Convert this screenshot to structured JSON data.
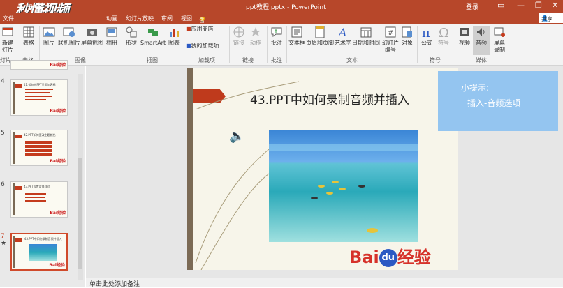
{
  "watermark": "秒懂视频",
  "window": {
    "title": "ppt教程.pptx - PowerPoint",
    "login": "登录",
    "minimize": "—",
    "restore": "❐",
    "close": "✕"
  },
  "tabs": [
    "文件",
    "动画",
    "幻灯片放映",
    "审阅",
    "视图"
  ],
  "tell_me": "告诉我你想要做什么",
  "share": "共享",
  "ribbon": {
    "new_slide": "新建\n灯片",
    "table": "表格",
    "picture": "图片",
    "online_picture": "联机图片",
    "screenshot": "屏幕截图",
    "album": "相册",
    "shapes": "形状",
    "smartart": "SmartArt",
    "chart": "图表",
    "store": "应用商店",
    "my_addins": "我的加载项",
    "link": "链接",
    "action": "动作",
    "comment": "批注",
    "textbox": "文本框",
    "header_footer": "页眉和页脚",
    "wordart": "艺术字",
    "datetime": "日期和时间",
    "slide_number": "幻灯片\n编号",
    "object": "对象",
    "equation": "公式",
    "symbol": "符号",
    "video": "视频",
    "audio": "音频",
    "screen_recording": "屏幕\n录制",
    "groups": {
      "slides": "灯片",
      "tables": "表格",
      "images": "图像",
      "illustrations": "插图",
      "addins": "加载项",
      "links": "链接",
      "comments": "批注",
      "text": "文本",
      "symbols": "符号",
      "media": "媒体"
    }
  },
  "thumbnails": [
    {
      "num": "4",
      "title": "41.如何在PPT里添加表格",
      "logo": "Bai经验"
    },
    {
      "num": "5",
      "title": "42.PPT如何更改主题颜色",
      "logo": "Bai经验"
    },
    {
      "num": "6",
      "title": "43.PPT设置背景样式",
      "logo": "Bai经验"
    },
    {
      "num": "7",
      "title": "43.PPT中如何录制音频并插入",
      "logo": "Bai经验",
      "marker": "★"
    }
  ],
  "slide": {
    "title": "43.PPT中如何录制音频并插入",
    "logo_bai": "Bai",
    "logo_du": "du",
    "logo_jingyan": "经验",
    "speaker_icon": "🔈"
  },
  "tip": {
    "heading": "小提示:",
    "body": "插入-音频选项"
  },
  "notes_placeholder": "单击此处添加备注"
}
